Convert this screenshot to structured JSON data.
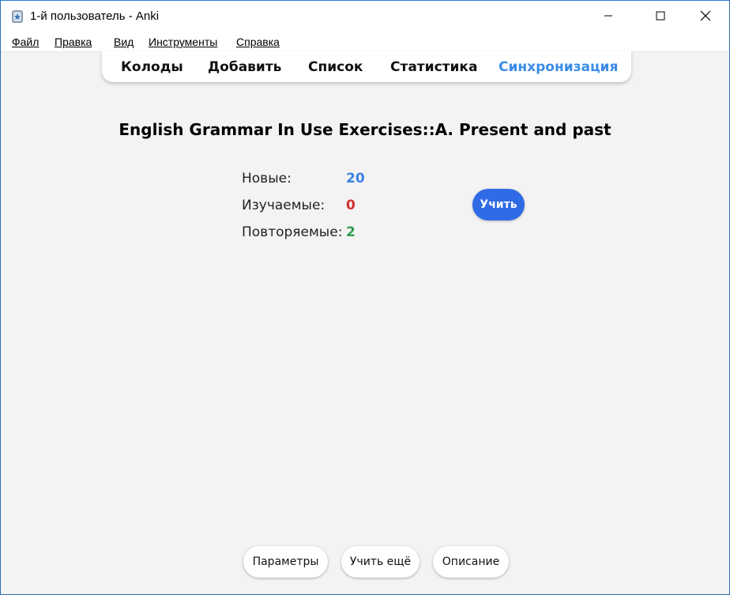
{
  "window": {
    "title": "1-й пользователь - Anki",
    "app_icon": "anki-icon"
  },
  "menu": {
    "items": [
      {
        "label": "Файл"
      },
      {
        "label": "Правка"
      },
      {
        "label": "Вид"
      },
      {
        "label": "Инструменты"
      },
      {
        "label": "Справка"
      }
    ]
  },
  "toolbar": {
    "links": [
      {
        "label": "Колоды"
      },
      {
        "label": "Добавить"
      },
      {
        "label": "Список"
      },
      {
        "label": "Статистика"
      },
      {
        "label": "Синхронизация"
      }
    ],
    "sync_color": "#3b8ce8"
  },
  "deck": {
    "title": "English Grammar In Use Exercises::A. Present and past",
    "counts": {
      "new": {
        "label": "Новые:",
        "value": "20",
        "color": "#3b82e6"
      },
      "learning": {
        "label": "Изучаемые:",
        "value": "0",
        "color": "#d32f2f"
      },
      "review": {
        "label": "Повторяемые:",
        "value": "2",
        "color": "#2e9a4c"
      }
    },
    "study_button": "Учить"
  },
  "bottom": {
    "options": "Параметры",
    "custom_study": "Учить ещё",
    "description": "Описание"
  }
}
